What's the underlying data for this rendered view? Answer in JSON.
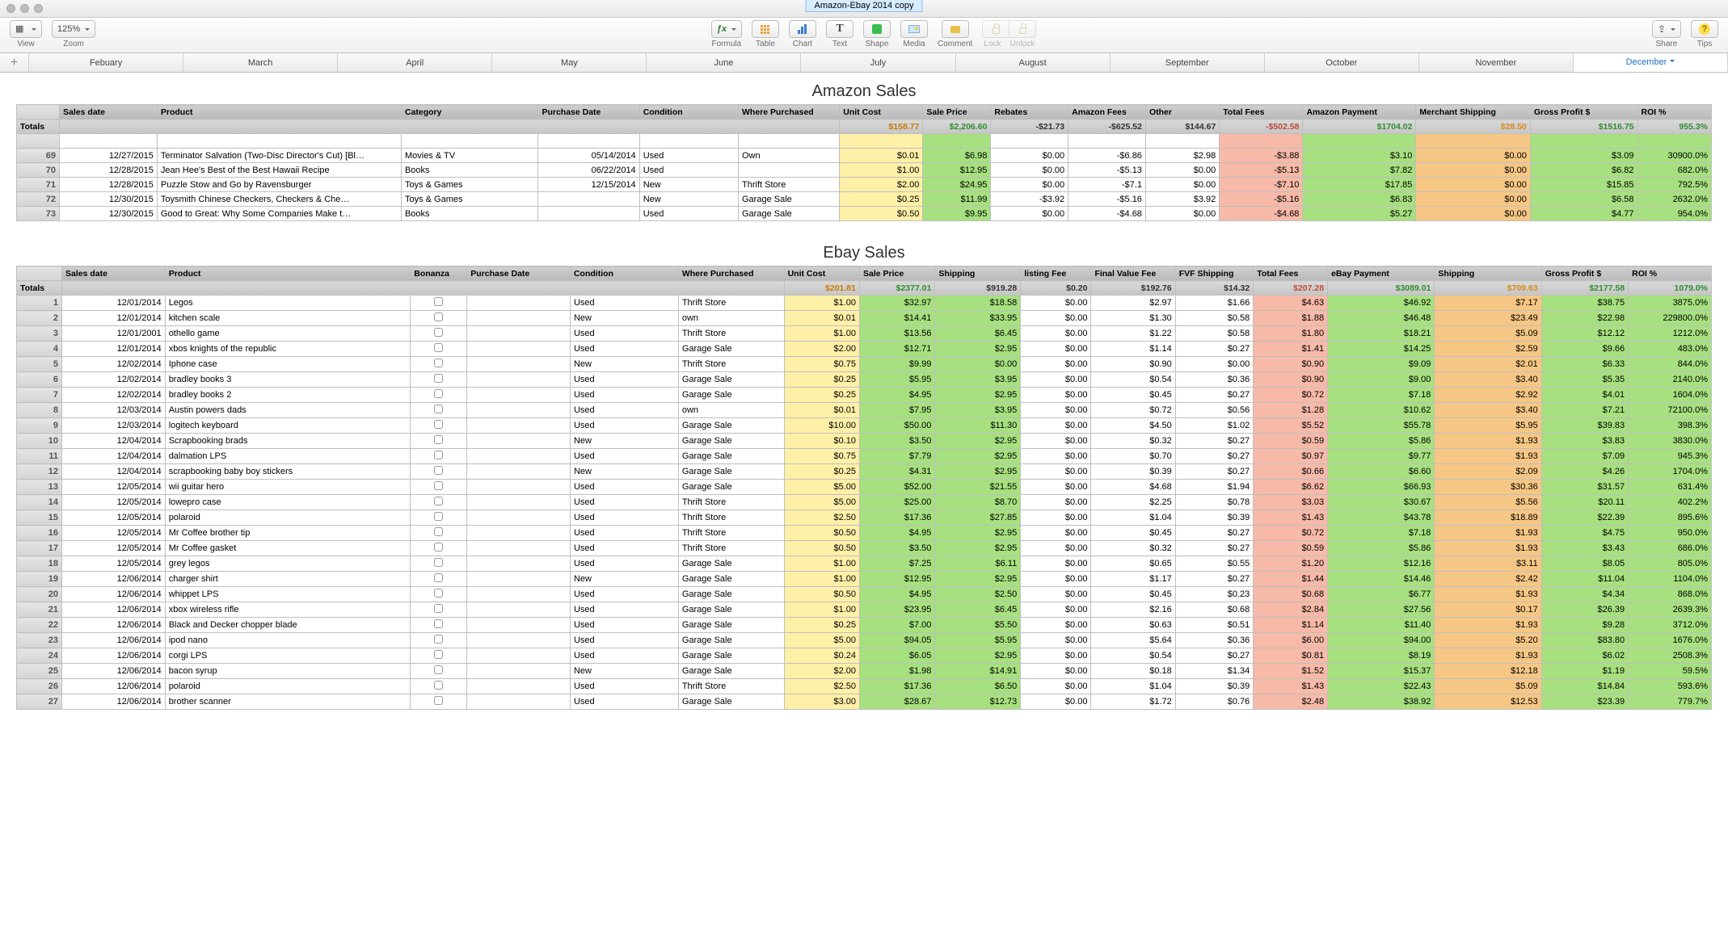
{
  "window": {
    "title": "Amazon-Ebay 2014 copy"
  },
  "toolbar": {
    "view": "View",
    "zoom": "Zoom",
    "zoom_value": "125%",
    "formula": "Formula",
    "table": "Table",
    "chart": "Chart",
    "text": "Text",
    "shape": "Shape",
    "media": "Media",
    "comment": "Comment",
    "lock": "Lock",
    "unlock": "Unlock",
    "share": "Share",
    "tips": "Tips",
    "formula_sym": "ƒx"
  },
  "sheets": {
    "items": [
      "Febuary",
      "March",
      "April",
      "May",
      "June",
      "July",
      "August",
      "September",
      "October",
      "November",
      "December"
    ],
    "active": "December"
  },
  "amazon": {
    "title": "Amazon Sales",
    "headers": [
      "Sales date",
      "Product",
      "Category",
      "Purchase Date",
      "Condition",
      "Where Purchased",
      "Unit Cost",
      "Sale Price",
      "Rebates",
      "Amazon Fees",
      "Other",
      "Total Fees",
      "Amazon Payment",
      "Merchant Shipping",
      "Gross Profit $",
      "ROI %"
    ],
    "totals_label": "Totals",
    "totals": [
      "$158.77",
      "$2,206.60",
      "-$21.73",
      "-$625.52",
      "$144.67",
      "-$502.58",
      "$1704.02",
      "$28.50",
      "$1516.75",
      "955.3%"
    ],
    "rows": [
      {
        "n": "",
        "partial": true,
        "date": "",
        "product": "",
        "category": "",
        "pdate": "",
        "cond": "",
        "where": "",
        "uc": "",
        "sp": "",
        "reb": "",
        "af": "",
        "oth": "",
        "tf": "",
        "pay": "",
        "ms": "",
        "gp": "",
        "roi": ""
      },
      {
        "n": "69",
        "date": "12/27/2015",
        "product": "Terminator Salvation (Two-Disc Director's Cut) [Bl…",
        "category": "Movies & TV",
        "pdate": "05/14/2014",
        "cond": "Used",
        "where": "Own",
        "uc": "$0.01",
        "sp": "$6.98",
        "reb": "$0.00",
        "af": "-$6.86",
        "oth": "$2.98",
        "tf": "-$3.88",
        "pay": "$3.10",
        "ms": "$0.00",
        "gp": "$3.09",
        "roi": "30900.0%"
      },
      {
        "n": "70",
        "date": "12/28/2015",
        "product": "Jean Hee's Best of the Best Hawaii Recipe",
        "category": "Books",
        "pdate": "06/22/2014",
        "cond": "Used",
        "where": "",
        "uc": "$1.00",
        "sp": "$12.95",
        "reb": "$0.00",
        "af": "-$5.13",
        "oth": "$0.00",
        "tf": "-$5.13",
        "pay": "$7.82",
        "ms": "$0.00",
        "gp": "$6.82",
        "roi": "682.0%"
      },
      {
        "n": "71",
        "date": "12/28/2015",
        "product": "Puzzle Stow and Go by Ravensburger",
        "category": "Toys & Games",
        "pdate": "12/15/2014",
        "cond": "New",
        "where": "Thrift Store",
        "uc": "$2.00",
        "sp": "$24.95",
        "reb": "$0.00",
        "af": "-$7.1",
        "oth": "$0.00",
        "tf": "-$7.10",
        "pay": "$17.85",
        "ms": "$0.00",
        "gp": "$15.85",
        "roi": "792.5%"
      },
      {
        "n": "72",
        "date": "12/30/2015",
        "product": "Toysmith Chinese Checkers, Checkers &#38; Che…",
        "category": "Toys & Games",
        "pdate": "",
        "cond": "New",
        "where": "Garage Sale",
        "uc": "$0.25",
        "sp": "$11.99",
        "reb": "-$3.92",
        "af": "-$5.16",
        "oth": "$3.92",
        "tf": "-$5.16",
        "pay": "$6.83",
        "ms": "$0.00",
        "gp": "$6.58",
        "roi": "2632.0%"
      },
      {
        "n": "73",
        "date": "12/30/2015",
        "product": "Good to Great: Why Some Companies Make t…",
        "category": "Books",
        "pdate": "",
        "cond": "Used",
        "where": "Garage Sale",
        "uc": "$0.50",
        "sp": "$9.95",
        "reb": "$0.00",
        "af": "-$4.68",
        "oth": "$0.00",
        "tf": "-$4.68",
        "pay": "$5.27",
        "ms": "$0.00",
        "gp": "$4.77",
        "roi": "954.0%"
      }
    ]
  },
  "ebay": {
    "title": "Ebay Sales",
    "headers": [
      "Sales date",
      "Product",
      "Bonanza",
      "Purchase Date",
      "Condition",
      "Where Purchased",
      "Unit Cost",
      "Sale Price",
      "Shipping",
      "listing Fee",
      "Final Value Fee",
      "FVF Shipping",
      "Total Fees",
      "eBay Payment",
      "Shipping",
      "Gross Profit $",
      "ROI %"
    ],
    "totals_label": "Totals",
    "totals": [
      "$201.81",
      "$2377.01",
      "$919.28",
      "$0.20",
      "$192.76",
      "$14.32",
      "$207.28",
      "$3089.01",
      "$709.63",
      "$2177.58",
      "1079.0%"
    ],
    "rows": [
      {
        "n": "1",
        "date": "12/01/2014",
        "product": "Legos",
        "cond": "Used",
        "where": "Thrift Store",
        "uc": "$1.00",
        "sp": "$32.97",
        "sh": "$18.58",
        "lf": "$0.00",
        "fvf": "$2.97",
        "fvs": "$1.66",
        "tf": "$4.63",
        "pay": "$46.92",
        "sh2": "$7.17",
        "gp": "$38.75",
        "roi": "3875.0%"
      },
      {
        "n": "2",
        "date": "12/01/2014",
        "product": "kitchen scale",
        "cond": "New",
        "where": "own",
        "uc": "$0.01",
        "sp": "$14.41",
        "sh": "$33.95",
        "lf": "$0.00",
        "fvf": "$1.30",
        "fvs": "$0.58",
        "tf": "$1.88",
        "pay": "$46.48",
        "sh2": "$23.49",
        "gp": "$22.98",
        "roi": "229800.0%"
      },
      {
        "n": "3",
        "date": "12/01/2001",
        "product": "othello game",
        "cond": "Used",
        "where": "Thrift Store",
        "uc": "$1.00",
        "sp": "$13.56",
        "sh": "$6.45",
        "lf": "$0.00",
        "fvf": "$1.22",
        "fvs": "$0.58",
        "tf": "$1.80",
        "pay": "$18.21",
        "sh2": "$5.09",
        "gp": "$12.12",
        "roi": "1212.0%"
      },
      {
        "n": "4",
        "date": "12/01/2014",
        "product": "xbos knights of the republic",
        "cond": "Used",
        "where": "Garage Sale",
        "uc": "$2.00",
        "sp": "$12.71",
        "sh": "$2.95",
        "lf": "$0.00",
        "fvf": "$1.14",
        "fvs": "$0.27",
        "tf": "$1.41",
        "pay": "$14.25",
        "sh2": "$2.59",
        "gp": "$9.66",
        "roi": "483.0%"
      },
      {
        "n": "5",
        "date": "12/02/2014",
        "product": "Iphone case",
        "cond": "New",
        "where": "Thrift Store",
        "uc": "$0.75",
        "sp": "$9.99",
        "sh": "$0.00",
        "lf": "$0.00",
        "fvf": "$0.90",
        "fvs": "$0.00",
        "tf": "$0.90",
        "pay": "$9.09",
        "sh2": "$2.01",
        "gp": "$6.33",
        "roi": "844.0%"
      },
      {
        "n": "6",
        "date": "12/02/2014",
        "product": "bradley books 3",
        "cond": "Used",
        "where": "Garage Sale",
        "uc": "$0.25",
        "sp": "$5.95",
        "sh": "$3.95",
        "lf": "$0.00",
        "fvf": "$0.54",
        "fvs": "$0.36",
        "tf": "$0.90",
        "pay": "$9.00",
        "sh2": "$3.40",
        "gp": "$5.35",
        "roi": "2140.0%"
      },
      {
        "n": "7",
        "date": "12/02/2014",
        "product": "bradley books 2",
        "cond": "Used",
        "where": "Garage Sale",
        "uc": "$0.25",
        "sp": "$4.95",
        "sh": "$2.95",
        "lf": "$0.00",
        "fvf": "$0.45",
        "fvs": "$0.27",
        "tf": "$0.72",
        "pay": "$7.18",
        "sh2": "$2.92",
        "gp": "$4.01",
        "roi": "1604.0%"
      },
      {
        "n": "8",
        "date": "12/03/2014",
        "product": "Austin powers dads",
        "cond": "Used",
        "where": "own",
        "uc": "$0.01",
        "sp": "$7.95",
        "sh": "$3.95",
        "lf": "$0.00",
        "fvf": "$0.72",
        "fvs": "$0.56",
        "tf": "$1.28",
        "pay": "$10.62",
        "sh2": "$3.40",
        "gp": "$7.21",
        "roi": "72100.0%"
      },
      {
        "n": "9",
        "date": "12/03/2014",
        "product": "logitech keyboard",
        "cond": "Used",
        "where": "Garage Sale",
        "uc": "$10.00",
        "sp": "$50.00",
        "sh": "$11.30",
        "lf": "$0.00",
        "fvf": "$4.50",
        "fvs": "$1.02",
        "tf": "$5.52",
        "pay": "$55.78",
        "sh2": "$5.95",
        "gp": "$39.83",
        "roi": "398.3%"
      },
      {
        "n": "10",
        "date": "12/04/2014",
        "product": "Scrapbooking brads",
        "cond": "New",
        "where": "Garage Sale",
        "uc": "$0.10",
        "sp": "$3.50",
        "sh": "$2.95",
        "lf": "$0.00",
        "fvf": "$0.32",
        "fvs": "$0.27",
        "tf": "$0.59",
        "pay": "$5.86",
        "sh2": "$1.93",
        "gp": "$3.83",
        "roi": "3830.0%"
      },
      {
        "n": "11",
        "date": "12/04/2014",
        "product": "dalmation LPS",
        "cond": "Used",
        "where": "Garage Sale",
        "uc": "$0.75",
        "sp": "$7.79",
        "sh": "$2.95",
        "lf": "$0.00",
        "fvf": "$0.70",
        "fvs": "$0.27",
        "tf": "$0.97",
        "pay": "$9.77",
        "sh2": "$1.93",
        "gp": "$7.09",
        "roi": "945.3%"
      },
      {
        "n": "12",
        "date": "12/04/2014",
        "product": "scrapbooking baby boy stickers",
        "cond": "New",
        "where": "Garage Sale",
        "uc": "$0.25",
        "sp": "$4.31",
        "sh": "$2.95",
        "lf": "$0.00",
        "fvf": "$0.39",
        "fvs": "$0.27",
        "tf": "$0.66",
        "pay": "$6.60",
        "sh2": "$2.09",
        "gp": "$4.26",
        "roi": "1704.0%"
      },
      {
        "n": "13",
        "date": "12/05/2014",
        "product": "wii guitar hero",
        "cond": "Used",
        "where": "Garage Sale",
        "uc": "$5.00",
        "sp": "$52.00",
        "sh": "$21.55",
        "lf": "$0.00",
        "fvf": "$4.68",
        "fvs": "$1.94",
        "tf": "$6.62",
        "pay": "$66.93",
        "sh2": "$30.36",
        "gp": "$31.57",
        "roi": "631.4%"
      },
      {
        "n": "14",
        "date": "12/05/2014",
        "product": "lowepro case",
        "cond": "Used",
        "where": "Thrift Store",
        "uc": "$5.00",
        "sp": "$25.00",
        "sh": "$8.70",
        "lf": "$0.00",
        "fvf": "$2.25",
        "fvs": "$0.78",
        "tf": "$3.03",
        "pay": "$30.67",
        "sh2": "$5.56",
        "gp": "$20.11",
        "roi": "402.2%"
      },
      {
        "n": "15",
        "date": "12/05/2014",
        "product": "polaroid",
        "cond": "Used",
        "where": "Thrift Store",
        "uc": "$2.50",
        "sp": "$17.36",
        "sh": "$27.85",
        "lf": "$0.00",
        "fvf": "$1.04",
        "fvs": "$0.39",
        "tf": "$1.43",
        "pay": "$43.78",
        "sh2": "$18.89",
        "gp": "$22.39",
        "roi": "895.6%"
      },
      {
        "n": "16",
        "date": "12/05/2014",
        "product": "Mr Coffee brother tip",
        "cond": "Used",
        "where": "Thrift Store",
        "uc": "$0.50",
        "sp": "$4.95",
        "sh": "$2.95",
        "lf": "$0.00",
        "fvf": "$0.45",
        "fvs": "$0.27",
        "tf": "$0.72",
        "pay": "$7.18",
        "sh2": "$1.93",
        "gp": "$4.75",
        "roi": "950.0%"
      },
      {
        "n": "17",
        "date": "12/05/2014",
        "product": "Mr Coffee gasket",
        "cond": "Used",
        "where": "Thrift Store",
        "uc": "$0.50",
        "sp": "$3.50",
        "sh": "$2.95",
        "lf": "$0.00",
        "fvf": "$0.32",
        "fvs": "$0.27",
        "tf": "$0.59",
        "pay": "$5.86",
        "sh2": "$1.93",
        "gp": "$3.43",
        "roi": "686.0%"
      },
      {
        "n": "18",
        "date": "12/05/2014",
        "product": "grey legos",
        "cond": "Used",
        "where": "Garage Sale",
        "uc": "$1.00",
        "sp": "$7.25",
        "sh": "$6.11",
        "lf": "$0.00",
        "fvf": "$0.65",
        "fvs": "$0.55",
        "tf": "$1.20",
        "pay": "$12.16",
        "sh2": "$3.11",
        "gp": "$8.05",
        "roi": "805.0%"
      },
      {
        "n": "19",
        "date": "12/06/2014",
        "product": "charger shirt",
        "cond": "New",
        "where": "Garage Sale",
        "uc": "$1.00",
        "sp": "$12.95",
        "sh": "$2.95",
        "lf": "$0.00",
        "fvf": "$1.17",
        "fvs": "$0.27",
        "tf": "$1.44",
        "pay": "$14.46",
        "sh2": "$2.42",
        "gp": "$11.04",
        "roi": "1104.0%"
      },
      {
        "n": "20",
        "date": "12/06/2014",
        "product": "whippet LPS",
        "cond": "Used",
        "where": "Garage Sale",
        "uc": "$0.50",
        "sp": "$4.95",
        "sh": "$2.50",
        "lf": "$0.00",
        "fvf": "$0.45",
        "fvs": "$0.23",
        "tf": "$0.68",
        "pay": "$6.77",
        "sh2": "$1.93",
        "gp": "$4.34",
        "roi": "868.0%"
      },
      {
        "n": "21",
        "date": "12/06/2014",
        "product": "xbox wireless rifle",
        "cond": "Used",
        "where": "Garage Sale",
        "uc": "$1.00",
        "sp": "$23.95",
        "sh": "$6.45",
        "lf": "$0.00",
        "fvf": "$2.16",
        "fvs": "$0.68",
        "tf": "$2.84",
        "pay": "$27.56",
        "sh2": "$0.17",
        "gp": "$26.39",
        "roi": "2639.3%"
      },
      {
        "n": "22",
        "date": "12/06/2014",
        "product": "Black and Decker chopper blade",
        "cond": "Used",
        "where": "Garage Sale",
        "uc": "$0.25",
        "sp": "$7.00",
        "sh": "$5.50",
        "lf": "$0.00",
        "fvf": "$0.63",
        "fvs": "$0.51",
        "tf": "$1.14",
        "pay": "$11.40",
        "sh2": "$1.93",
        "gp": "$9.28",
        "roi": "3712.0%"
      },
      {
        "n": "23",
        "date": "12/06/2014",
        "product": "ipod nano",
        "cond": "Used",
        "where": "Garage Sale",
        "uc": "$5.00",
        "sp": "$94.05",
        "sh": "$5.95",
        "lf": "$0.00",
        "fvf": "$5.64",
        "fvs": "$0.36",
        "tf": "$6.00",
        "pay": "$94.00",
        "sh2": "$5.20",
        "gp": "$83.80",
        "roi": "1676.0%"
      },
      {
        "n": "24",
        "date": "12/06/2014",
        "product": "corgi LPS",
        "cond": "Used",
        "where": "Garage Sale",
        "uc": "$0.24",
        "sp": "$6.05",
        "sh": "$2.95",
        "lf": "$0.00",
        "fvf": "$0.54",
        "fvs": "$0.27",
        "tf": "$0.81",
        "pay": "$8.19",
        "sh2": "$1.93",
        "gp": "$6.02",
        "roi": "2508.3%"
      },
      {
        "n": "25",
        "date": "12/06/2014",
        "product": "bacon syrup",
        "cond": "New",
        "where": "Garage Sale",
        "uc": "$2.00",
        "sp": "$1.98",
        "sh": "$14.91",
        "lf": "$0.00",
        "fvf": "$0.18",
        "fvs": "$1.34",
        "tf": "$1.52",
        "pay": "$15.37",
        "sh2": "$12.18",
        "gp": "$1.19",
        "roi": "59.5%"
      },
      {
        "n": "26",
        "date": "12/06/2014",
        "product": "polaroid",
        "cond": "Used",
        "where": "Thrift Store",
        "uc": "$2.50",
        "sp": "$17.36",
        "sh": "$6.50",
        "lf": "$0.00",
        "fvf": "$1.04",
        "fvs": "$0.39",
        "tf": "$1.43",
        "pay": "$22.43",
        "sh2": "$5.09",
        "gp": "$14.84",
        "roi": "593.6%"
      },
      {
        "n": "27",
        "date": "12/06/2014",
        "product": "brother scanner",
        "cond": "Used",
        "where": "Garage Sale",
        "uc": "$3.00",
        "sp": "$28.67",
        "sh": "$12.73",
        "lf": "$0.00",
        "fvf": "$1.72",
        "fvs": "$0.76",
        "tf": "$2.48",
        "pay": "$38.92",
        "sh2": "$12.53",
        "gp": "$23.39",
        "roi": "779.7%"
      }
    ]
  }
}
